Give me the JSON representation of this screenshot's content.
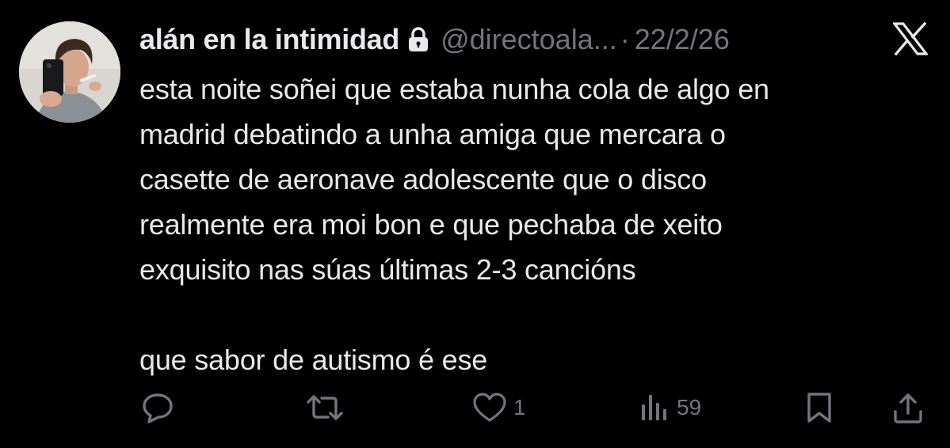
{
  "tweet": {
    "display_name": "alán en la intimidad",
    "handle": "@directoala...",
    "separator": "·",
    "date": "22/2/26",
    "text": "esta noite soñei que estaba nunha cola de algo en\nmadrid debatindo a unha amiga que mercara o\ncasette de aeronave adolescente que o disco\nrealmente era moi bon e que pechaba de xeito\nexquisito nas súas últimas 2-3 cancións\n\nque sabor de autismo é ese"
  },
  "actions": {
    "reply": {
      "icon": "reply-icon",
      "count": ""
    },
    "retweet": {
      "icon": "retweet-icon",
      "count": ""
    },
    "like": {
      "icon": "heart-icon",
      "count": "1"
    },
    "views": {
      "icon": "views-icon",
      "count": "59"
    },
    "bookmark": {
      "icon": "bookmark-icon"
    },
    "share": {
      "icon": "share-icon"
    }
  },
  "colors": {
    "background": "#000000",
    "primary_text": "#e7e9ea",
    "secondary_text": "#71767b"
  }
}
